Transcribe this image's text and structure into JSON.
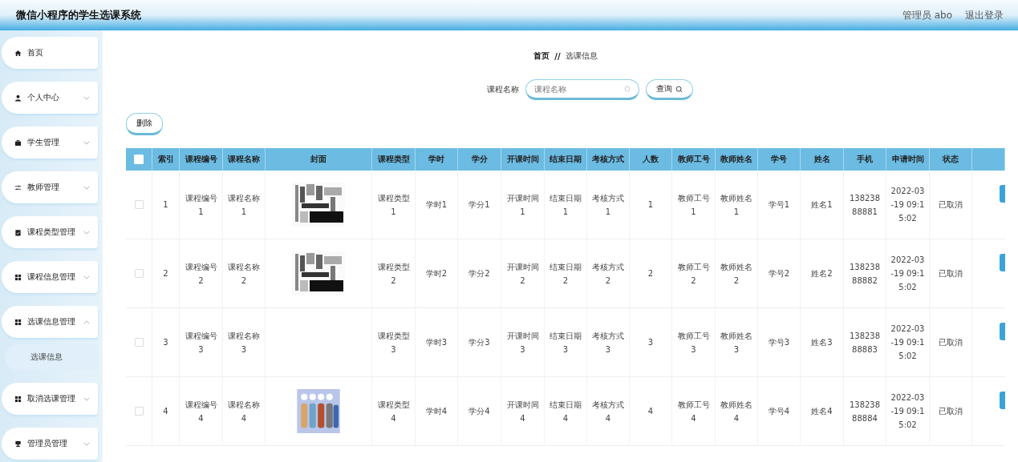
{
  "header": {
    "title": "微信小程序的学生选课系统",
    "user": "管理员 abo",
    "logout": "退出登录"
  },
  "sidebar": {
    "items": [
      {
        "label": "首页",
        "expandable": false
      },
      {
        "label": "个人中心",
        "expandable": true,
        "expanded": false
      },
      {
        "label": "学生管理",
        "expandable": true,
        "expanded": false
      },
      {
        "label": "教师管理",
        "expandable": true,
        "expanded": false
      },
      {
        "label": "课程类型管理",
        "expandable": true,
        "expanded": false
      },
      {
        "label": "课程信息管理",
        "expandable": true,
        "expanded": false
      },
      {
        "label": "选课信息管理",
        "expandable": true,
        "expanded": true,
        "children": [
          {
            "label": "选课信息",
            "selected": true
          }
        ]
      },
      {
        "label": "取消选课管理",
        "expandable": true,
        "expanded": false
      },
      {
        "label": "管理员管理",
        "expandable": true,
        "expanded": false
      }
    ]
  },
  "breadcrumb": {
    "home": "首页",
    "separator": "//",
    "current": "选课信息"
  },
  "search": {
    "label": "课程名称",
    "placeholder": "课程名称",
    "button": "查询"
  },
  "delete_button": "删除",
  "table": {
    "header_checkbox": {
      "checked": false
    },
    "columns": [
      {
        "label": "索引"
      },
      {
        "label": "课程编号"
      },
      {
        "label": "课程名称"
      },
      {
        "label": "封面"
      },
      {
        "label": "课程类型"
      },
      {
        "label": "学时"
      },
      {
        "label": "学分"
      },
      {
        "label": "开课时间"
      },
      {
        "label": "结束日期"
      },
      {
        "label": "考核方式"
      },
      {
        "label": "人数"
      },
      {
        "label": "教师工号"
      },
      {
        "label": "教师姓名"
      },
      {
        "label": "学号"
      },
      {
        "label": "姓名"
      },
      {
        "label": "手机"
      },
      {
        "label": "申请时间"
      },
      {
        "label": "状态"
      }
    ],
    "rows": [
      {
        "checked": false,
        "cells": [
          "1",
          "课程编号1",
          "课程名称1",
          {
            "kind": "picture"
          },
          "课程类型1",
          "学时1",
          "学分1",
          "开课时间1",
          "结束日期1",
          "考核方式1",
          "1",
          "教师工号1",
          "教师姓名1",
          "学号1",
          "姓名1",
          "13823888881",
          "2022-03-19 09:15:02",
          "已取消"
        ]
      },
      {
        "checked": false,
        "cells": [
          "2",
          "课程编号2",
          "课程名称2",
          {
            "kind": "picture"
          },
          "课程类型2",
          "学时2",
          "学分2",
          "开课时间2",
          "结束日期2",
          "考核方式2",
          "2",
          "教师工号2",
          "教师姓名2",
          "学号2",
          "姓名2",
          "13823888882",
          "2022-03-19 09:15:02",
          "已取消"
        ]
      },
      {
        "checked": false,
        "cells": [
          "3",
          "课程编号3",
          "课程名称3",
          "",
          "课程类型3",
          "学时3",
          "学分3",
          "开课时间3",
          "结束日期3",
          "考核方式3",
          "3",
          "教师工号3",
          "教师姓名3",
          "学号3",
          "姓名3",
          "13823888883",
          "2022-03-19 09:15:02",
          "已取消"
        ]
      },
      {
        "checked": false,
        "cells": [
          "4",
          "课程编号4",
          "课程名称4",
          {
            "kind": "picture"
          },
          "课程类型4",
          "学时4",
          "学分4",
          "开课时间4",
          "结束日期4",
          "考核方式4",
          "4",
          "教师工号4",
          "教师姓名4",
          "学号4",
          "姓名4",
          "13823888884",
          "2022-03-19 09:15:02",
          "已取消"
        ]
      }
    ]
  }
}
